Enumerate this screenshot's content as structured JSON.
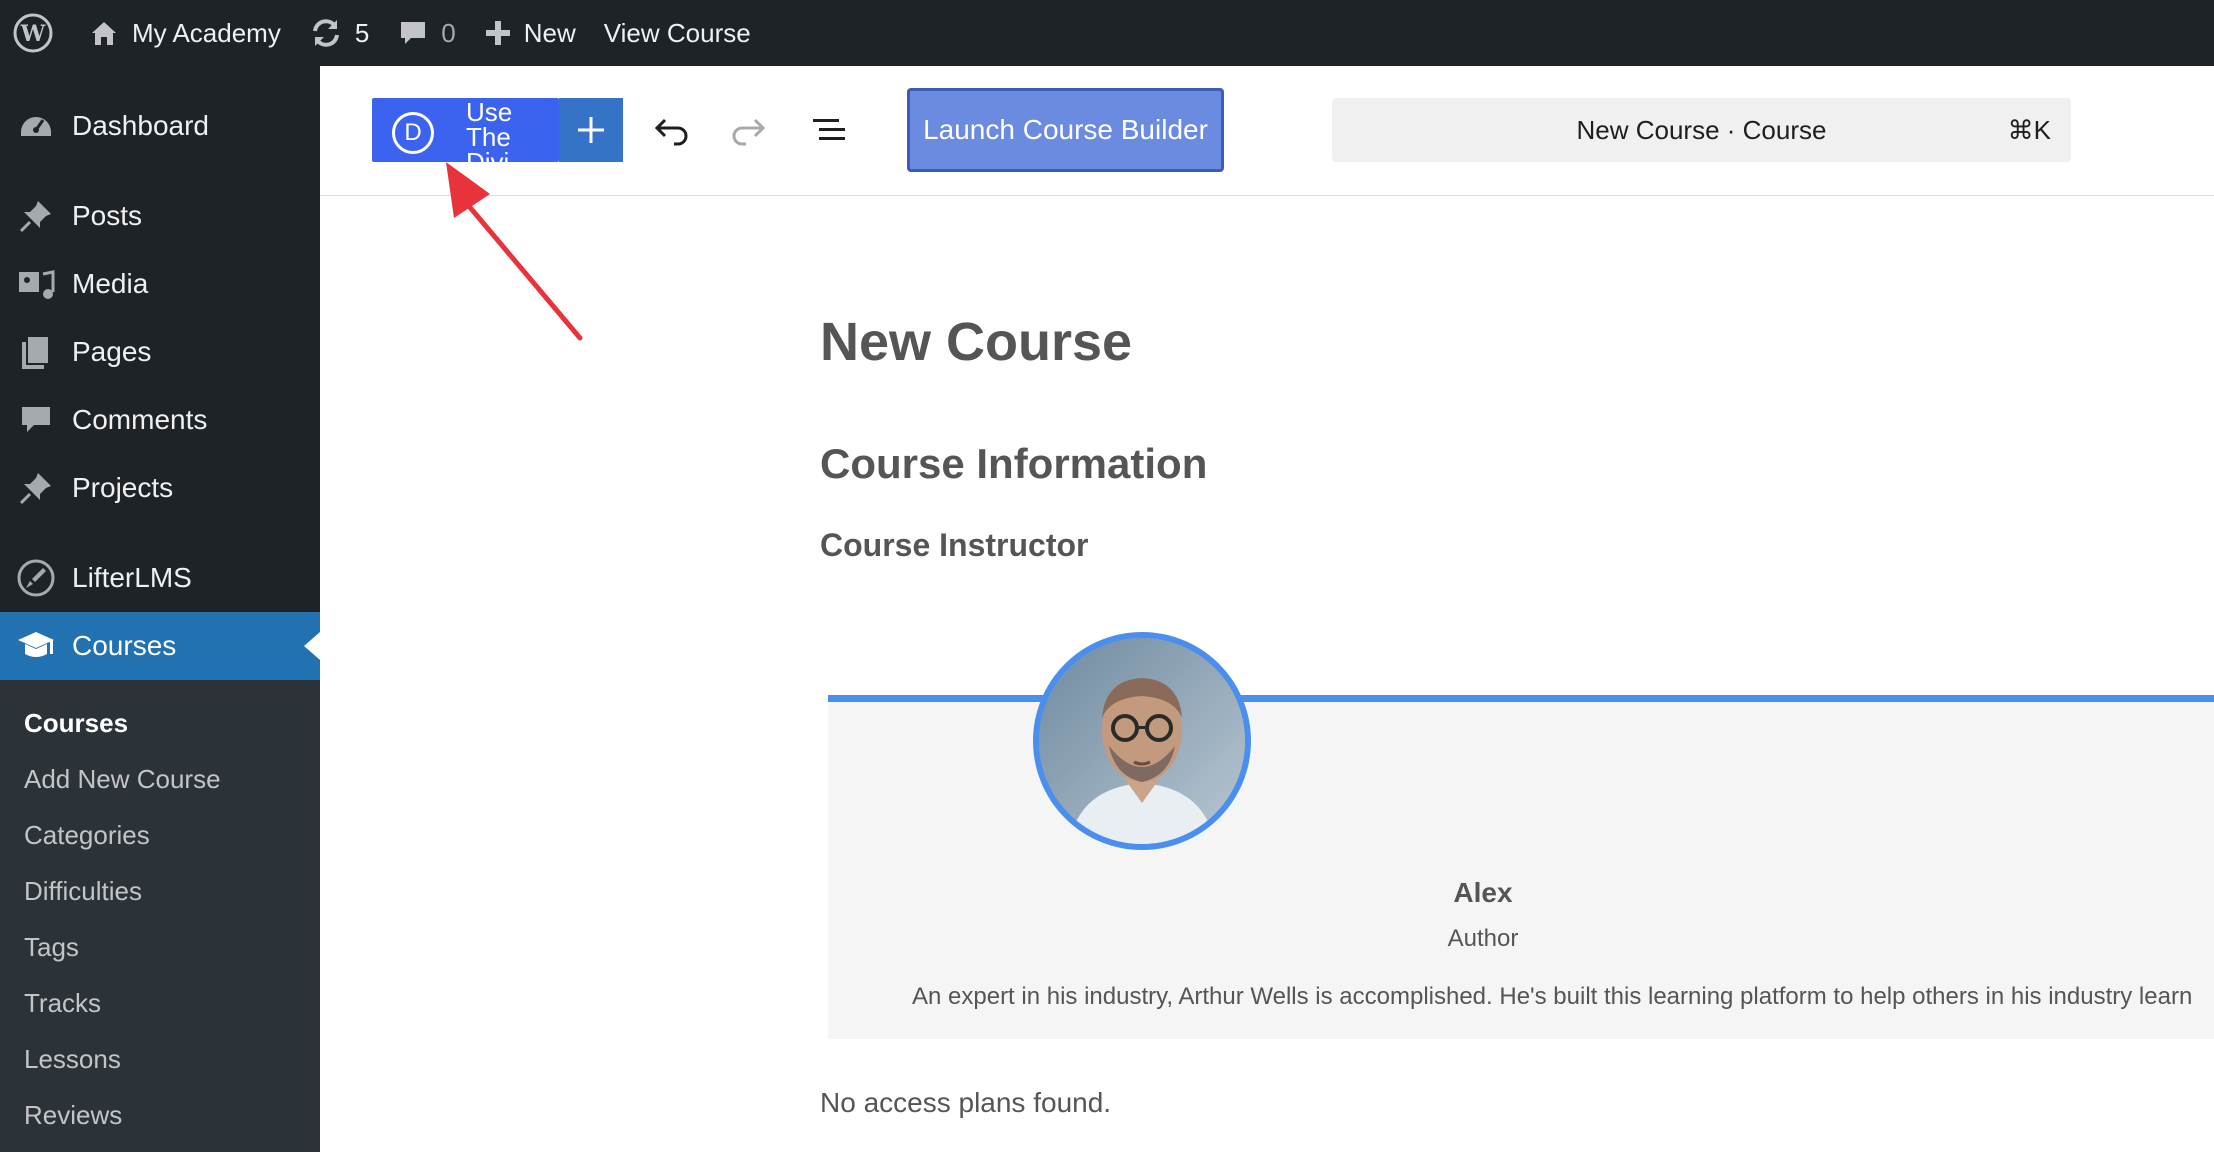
{
  "admin_bar": {
    "site_name": "My Academy",
    "updates_count": "5",
    "comments_count": "0",
    "new_label": "New",
    "view_label": "View Course"
  },
  "sidebar": {
    "items": [
      {
        "label": "Dashboard",
        "icon": "dashboard-icon"
      },
      {
        "label": "Posts",
        "icon": "pin-icon"
      },
      {
        "label": "Media",
        "icon": "media-icon"
      },
      {
        "label": "Pages",
        "icon": "pages-icon"
      },
      {
        "label": "Comments",
        "icon": "comment-icon"
      },
      {
        "label": "Projects",
        "icon": "pin-icon"
      },
      {
        "label": "LifterLMS",
        "icon": "rocket-icon"
      },
      {
        "label": "Courses",
        "icon": "graduation-cap-icon",
        "active": true
      }
    ],
    "submenu": [
      {
        "label": "Courses",
        "current": true
      },
      {
        "label": "Add New Course"
      },
      {
        "label": "Categories"
      },
      {
        "label": "Difficulties"
      },
      {
        "label": "Tags"
      },
      {
        "label": "Tracks"
      },
      {
        "label": "Lessons"
      },
      {
        "label": "Reviews"
      }
    ]
  },
  "toolbar": {
    "divi_letter": "D",
    "divi_label": "Use The Divi Builder",
    "launch_label": "Launch Course Builder",
    "command_title": "New Course · Course",
    "command_shortcut": "⌘K"
  },
  "content": {
    "page_title": "New Course",
    "section_heading": "Course Information",
    "sub_heading": "Course Instructor",
    "author": {
      "name": "Alex",
      "role": "Author",
      "bio": "An expert in his industry, Arthur Wells is accomplished. He's built this learning platform to help others in his industry learn"
    },
    "no_plans": "No access plans found."
  },
  "colors": {
    "admin_bg": "#1d2327",
    "active_blue": "#2271b1",
    "divi_blue": "#3b63f0",
    "launch_blue": "#6b8be0",
    "card_accent": "#4a8ef0",
    "annotation_red": "#e8323c"
  }
}
